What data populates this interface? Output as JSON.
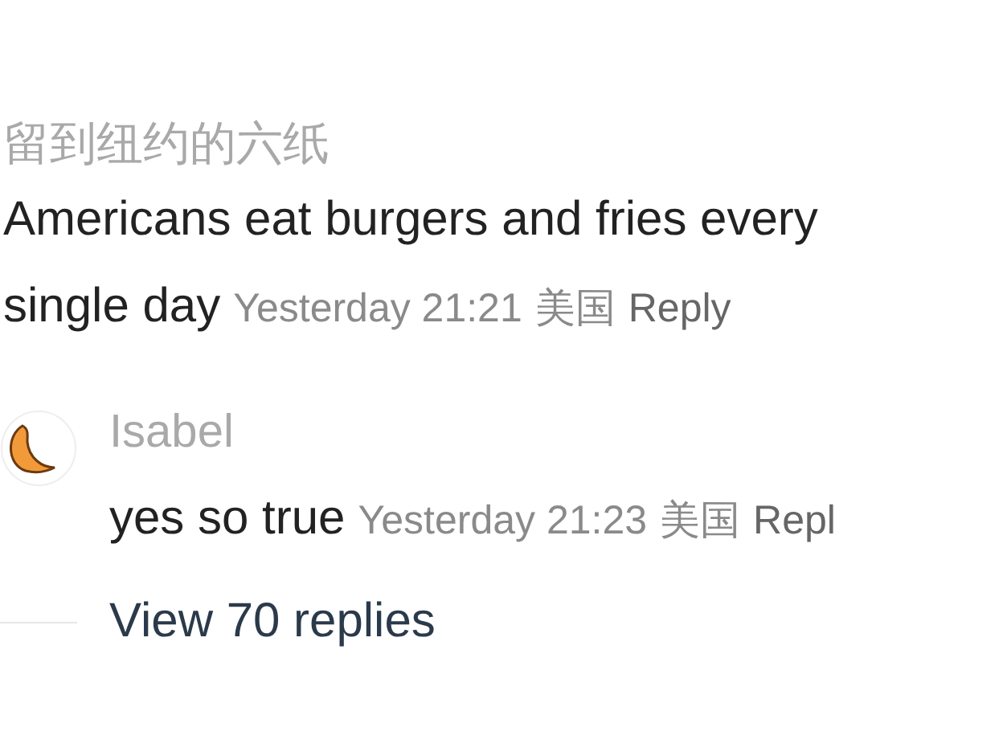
{
  "comment": {
    "username": "留到纽约的六纸",
    "text_lines": [
      "Americans eat burgers and fries every",
      "single day"
    ],
    "time": "Yesterday 21:21",
    "location": "美国",
    "reply_action": "Reply"
  },
  "replies": [
    {
      "username": "Isabel",
      "text": "yes so true",
      "time": "Yesterday 21:23",
      "location": "美国",
      "reply_action": "Repl"
    }
  ],
  "view_replies": "View 70 replies"
}
